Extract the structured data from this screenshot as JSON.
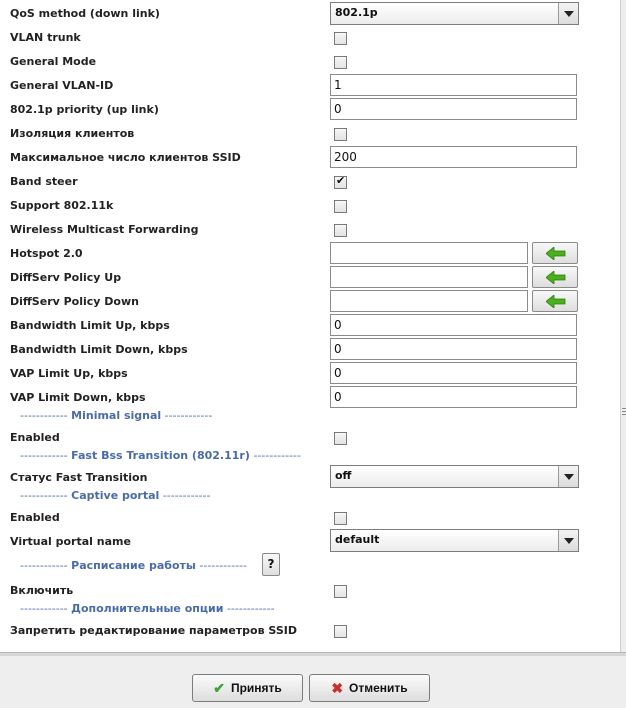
{
  "fields": {
    "qos_method": {
      "label": "QoS method (down link)",
      "value": "802.1p"
    },
    "vlan_trunk": {
      "label": "VLAN trunk",
      "checked": false
    },
    "general_mode": {
      "label": "General Mode",
      "checked": false
    },
    "general_vlan_id": {
      "label": "General VLAN-ID",
      "value": "1"
    },
    "priority_up": {
      "label": "802.1p priority (up link)",
      "value": "0"
    },
    "client_isolation": {
      "label": "Изоляция клиентов",
      "checked": false
    },
    "max_clients": {
      "label": "Максимальное число клиентов SSID",
      "value": "200"
    },
    "band_steer": {
      "label": "Band steer",
      "checked": true
    },
    "support_80211k": {
      "label": "Support 802.11k",
      "checked": false
    },
    "wireless_multicast": {
      "label": "Wireless Multicast Forwarding",
      "checked": false
    },
    "hotspot20": {
      "label": "Hotspot 2.0",
      "value": ""
    },
    "diffserv_up": {
      "label": "DiffServ Policy Up",
      "value": ""
    },
    "diffserv_down": {
      "label": "DiffServ Policy Down",
      "value": ""
    },
    "bw_up": {
      "label": "Bandwidth Limit Up, kbps",
      "value": "0"
    },
    "bw_down": {
      "label": "Bandwidth Limit Down, kbps",
      "value": "0"
    },
    "vap_up": {
      "label": "VAP Limit Up, kbps",
      "value": "0"
    },
    "vap_down": {
      "label": "VAP Limit Down, kbps",
      "value": "0"
    }
  },
  "minimal_signal": {
    "dashes": "------------",
    "title": "Minimal signal",
    "enabled": {
      "label": "Enabled",
      "checked": false
    }
  },
  "fast_bss": {
    "dashes": "------------",
    "title": "Fast Bss Transition (802.11r)",
    "status": {
      "label": "Статус Fast Transition",
      "value": "off"
    }
  },
  "captive_portal": {
    "dashes": "------------",
    "title": "Captive portal",
    "enabled": {
      "label": "Enabled",
      "checked": false
    },
    "portal_name": {
      "label": "Virtual portal name",
      "value": "default"
    }
  },
  "schedule": {
    "dashes": "------------",
    "title": "Расписание работы",
    "help": "?",
    "enable": {
      "label": "Включить",
      "checked": false
    }
  },
  "extra": {
    "dashes": "------------",
    "title": "Дополнительные опции",
    "forbid_edit": {
      "label": "Запретить редактирование параметров SSID",
      "checked": false
    }
  },
  "buttons": {
    "accept": "Принять",
    "cancel": "Отменить"
  },
  "icons": {
    "apply_arrow": "arrow-left-icon",
    "accept": "check-icon",
    "cancel": "x-icon"
  },
  "colors": {
    "section": "#4a6bab",
    "arrow_green": "#4caf1f"
  }
}
